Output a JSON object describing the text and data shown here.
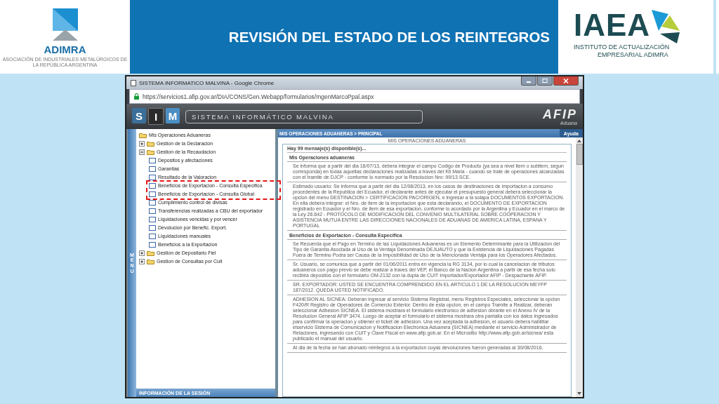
{
  "slide": {
    "title": "REVISIÓN DEL ESTADO DE LOS REINTEGROS",
    "left_logo": {
      "name": "ADIMRA",
      "subtitle": "ASOCIACIÓN DE INDUSTRIALES METALÚRGICOS DE LA REPÚBLICA ARGENTINA"
    },
    "right_logo": {
      "name": "IAEA",
      "line1": "INSTITUTO DE ACTUALIZACIÓN",
      "line2": "EMPRESARIAL ADIMRA"
    }
  },
  "browser": {
    "title": "SISTEMA INFORMATICO MALVINA - Google Chrome",
    "url": "https://servicios1.afip.gov.ar/DIA/CONS/Gen.Webapp/formularios/mgenMarcoPpal.aspx"
  },
  "app": {
    "logo_letters": [
      "S",
      "I",
      "M"
    ],
    "name": "SISTEMA INFORMÁTICO MALVINA",
    "agency": "AFIP",
    "agency_sub": "Aduana"
  },
  "menu": {
    "label": "MENU",
    "session_label": "INFORMACIÓN DE LA SESIÓN",
    "tree": {
      "label": "Mis Operaciones Aduaneras",
      "children": [
        {
          "label": "Gestion de la Declaracion",
          "expanded": false
        },
        {
          "label": "Gestion de la Recaudacion",
          "expanded": true,
          "children": [
            {
              "label": "Depositos y afectaciones"
            },
            {
              "label": "Garantias"
            },
            {
              "label": "Resultado de la Valoracion"
            },
            {
              "label": "Beneficios de Exportacion - Consulta Especifica"
            },
            {
              "label": "Beneficios de Exportacion - Consulta Global"
            },
            {
              "label": "Cumplimiento control de divisas"
            },
            {
              "label": "Transferencias realizadas a CBU del exportador"
            },
            {
              "label": "Liquidaciones vencidas y por vencer"
            },
            {
              "label": "Devolucion por Benefic. Export."
            },
            {
              "label": "Liquidaciones manuales"
            },
            {
              "label": "Beneficios a la Exportacion"
            }
          ]
        },
        {
          "label": "Gestion de Depositario Fiel",
          "expanded": false
        },
        {
          "label": "Gestion de Consultas por Cuit",
          "expanded": false
        }
      ]
    }
  },
  "main": {
    "breadcrumb": "MIS OPERACIONES ADUANERAS > PRINCIPAL",
    "help": "Ayuda",
    "heading": "MIS OPERACIONES ADUANERAS",
    "count_text": "Hay 99 mensaje(s) disponible(s)...",
    "sections": [
      {
        "title": "Mis Operaciones aduaneras",
        "messages": [
          "Se informa que a partir del dia 16/07/13, debera integrar el campo Codigo de Producto (ya sea a nivel item o subitem, segun corresponda) en todas aquellas declaraciones realizadas a traves del Kit Maria - cuando se trate de operaciones alcanzadas con el tramite de DJCP - conforme lo normado por la Resolucion Nro: 99/13 SCE.",
          "Estimado usuario: Se informa que a partir del dia 12/08/2013, en los casos de destinaciones de importacion a consumo procedentes de la Republica del Ecuador, el declarante antes de ejecutar el presupuesto general debera seleccionar la opcion del menu DESTINACION > CERTIFICACION PAC/ORIGEN, e ingresar a la solapa DOCUMENTOS EXPORTACION. En ella debera integrar: el Nro. de item de la importacion que esta declarando, el DOCUMENTO DE EXPORTACION registrado en Ecuador y el Nro. de item de esa exportacion, conforme lo acordado por la Argentina y Ecuador en el marco de la Ley 26.642 - PROTOCOLO DE MODIFICACION DEL CONVENIO MULTILATERAL SOBRE COOPERACION Y ASISTENCIA MUTUA ENTRE LAS DIRECCIONES NACIONALES DE ADUANAS DE AMERICA LATINA, ESPANA Y PORTUGAL"
        ]
      },
      {
        "title": "Beneficios de Exportacion - Consulta Especifica",
        "messages": [
          "Se Recuerda que el Pago en Termino de las Liquidaciones Aduaneras es un Elemento Determinante para la Utilizacion del Tipo de Garantia Asociada al Uso de la Ventaja Denominada DEJUAUTO y que la Existencia de Liquidaciones Pagadas Fuera de Termino Podra ser Causa de la Imposibilidad de Uso de la Mencionada Ventaja para los Operadores Afectados.",
          "Sr. Usuario, se comunica que a partir del 01/06/2011 entra en vigencia la RG 3134, por lo cual la cancelacion de tributos aduaneros con pago previo se debe realizar a traves del VEP, el Banco de la Nacion Argentina a partir de esa fecha solo recibira depositos con el formulario OM-2132 con la dupla de CUIT Importador/Exportador AFIP - Despachante AFIP.",
          "SR. EXPORTADOR: USTED SE ENCUENTRA COMPRENDIDO EN EL ARTICULO 1 DE LA RESOLUCION MEYFP 187/2012. QUEDA USTED NOTIFICADO.",
          "ADHESION AL SICNEA: Deberan ingresar al servicio Sistema Registral, menu Registros Especiales, seleccionar la opcion F420/R Registro de Operadores de Comercio Exterior. Dentro de esta opcion, en el campo Tramite a Realizar, deberan seleccionar Adhesion SICNEA. El sistema mostrara el formulario electronico de adhesion obrante en el Anexo IV de la Resolucion General AFIP 3474. Luego de aceptar el formulario el sistema mostrara otra pantalla con los datos ingresados para confirmar la operacion y obtener el ticket de adhesion. Una vez aceptada la adhesion, el usuario debera habilitar elservicio Sistema de Comunicacion y Notificacion Electronica Aduanera (SICNEA) mediante el servicio Administrador de Relaciones, ingresando con CUIT y Clave Fiscal en www.afip.gob.ar. En el Micrositio http://www.afip.gob.ar/sicnea/ esta publicado el manual del usuario.",
          "Al dia de la fecha se han abonado reintegros a la exportacion cuyas devoluciones fueron generadas al 30/08/2016."
        ]
      }
    ]
  }
}
